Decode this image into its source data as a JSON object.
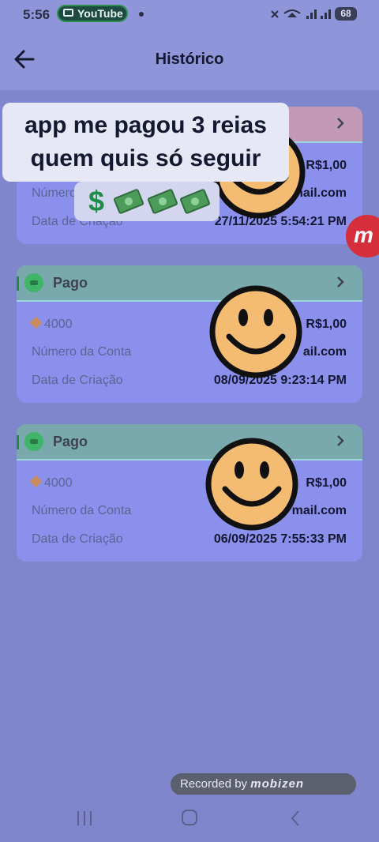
{
  "status_bar": {
    "time": "5:56",
    "notification_app": "YouTube",
    "battery": "68"
  },
  "header": {
    "title": "Histórico"
  },
  "transactions": [
    {
      "status": "",
      "plan": "",
      "amount": "R$1,00",
      "account_label": "Número",
      "account_value": "gmail.com",
      "date_label": "Data de Criação",
      "date_value": "27/11/2025 5:54:21 PM"
    },
    {
      "status": "Pago",
      "plan": "4000",
      "amount": "R$1,00",
      "account_label": "Número da Conta",
      "account_value": "ail.com",
      "date_label": "Data de Criação",
      "date_value": "08/09/2025 9:23:14 PM"
    },
    {
      "status": "Pago",
      "plan": "4000",
      "amount": "R$1,00",
      "account_label": "Número da Conta",
      "account_value": "mail.com",
      "date_label": "Data de Criação",
      "date_value": "06/09/2025 7:55:33 PM"
    }
  ],
  "overlay": {
    "caption_line1": "app me pagou 3 reias",
    "caption_line2": "quem quis só seguir"
  },
  "recorder": {
    "prefix": "Recorded by",
    "brand": "mobizen",
    "fab_label": "m"
  },
  "colors": {
    "background": "#7f86cc",
    "card": "#8a90ec",
    "paid_header": "#79a9ad",
    "accent_green": "#1f8c4a",
    "fab_red": "#d62f3c"
  }
}
